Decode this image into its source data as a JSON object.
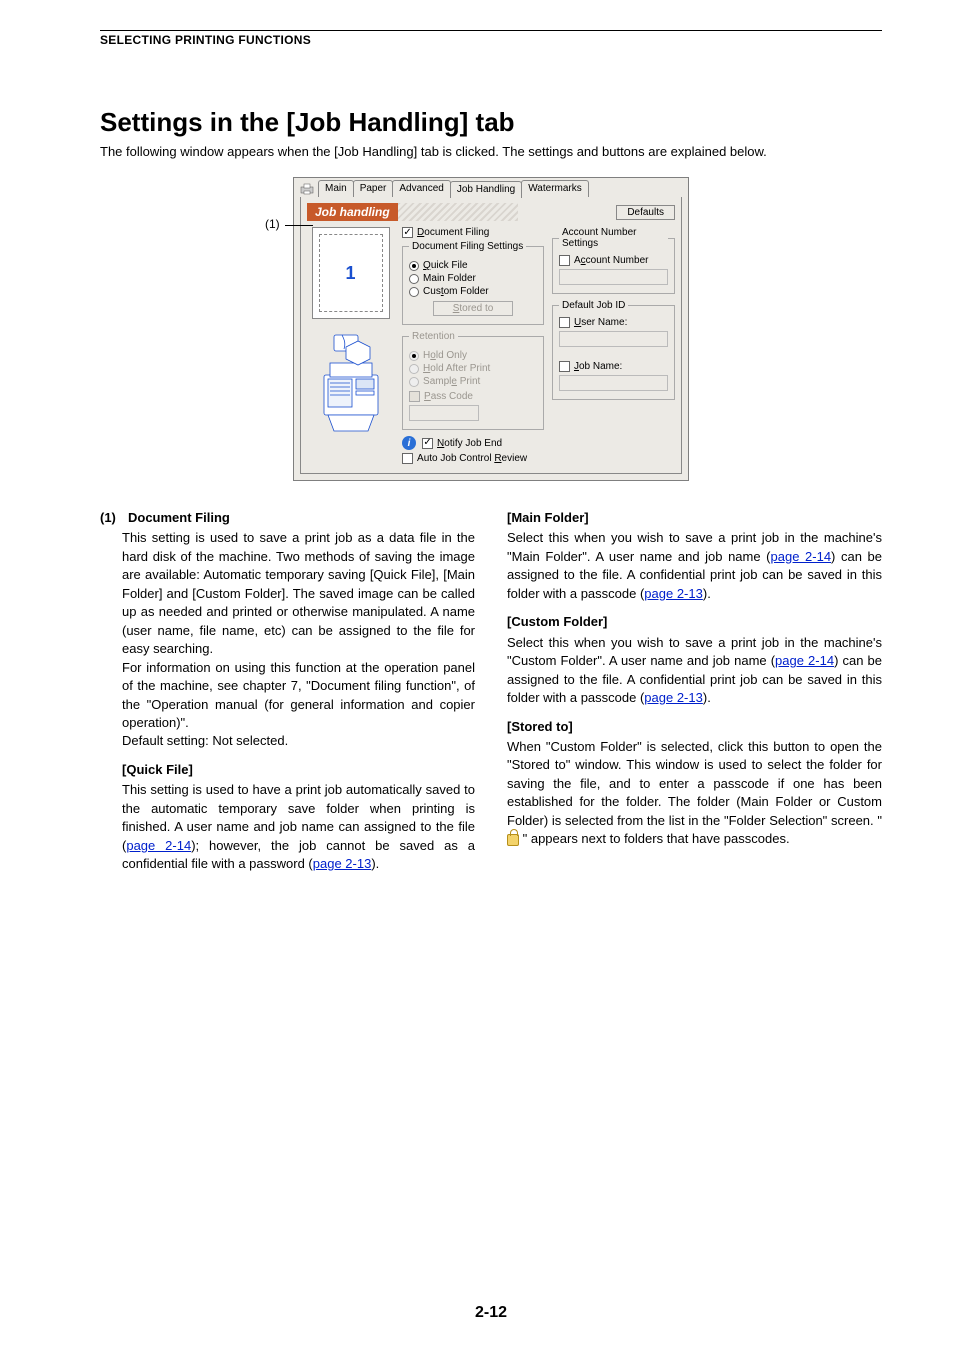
{
  "header": {
    "section": "SELECTING PRINTING FUNCTIONS"
  },
  "title": "Settings in the [Job Handling] tab",
  "intro": "The following window appears when the [Job Handling] tab is clicked. The settings and buttons are explained below.",
  "callout1": "(1)",
  "dialog": {
    "tabs": {
      "main": "Main",
      "paper": "Paper",
      "advanced": "Advanced",
      "job": "Job Handling",
      "water": "Watermarks"
    },
    "banner": "Job handling",
    "defaults": "Defaults",
    "preview_num": "1",
    "doc_filing": "Document Filing",
    "dfs_legend": "Document Filing Settings",
    "quick": "Quick File",
    "mainf": "Main Folder",
    "customf": "Custom Folder",
    "stored": "Stored to",
    "ret_legend": "Retention",
    "hold_only": "Hold Only",
    "hold_after": "Hold After Print",
    "sample": "Sample Print",
    "passcode": "Pass Code",
    "notify": "Notify Job End",
    "autoreview": "Auto Job Control Review",
    "acct_legend": "Account Number Settings",
    "acct_num": "Account Number",
    "def_legend": "Default Job ID",
    "user_name": "User Name:",
    "job_name": "Job Name:"
  },
  "left": {
    "hd1_num": "(1)",
    "hd1": "Document Filing",
    "p1": "This setting is used to save a print job as a data file in the hard disk of the machine. Two methods of saving the image are available: Automatic temporary saving [Quick File], [Main Folder] and [Custom Folder]. The saved image can be called up as needed and printed or otherwise manipulated. A name (user name, file name, etc) can be assigned to the file for easy searching.",
    "p2a": "For information on using this function at the operation panel of the machine, see chapter 7, \"Document filing function\", of the \"Operation manual (for general information and copier operation)\".",
    "p2b": "Default setting: Not selected.",
    "sub1": "[Quick File]",
    "p3a": "This setting is used to have a print job automatically saved to the automatic temporary save folder when printing is finished. A user name and job name can assigned to the file (",
    "p3link": "page 2-14",
    "p3b": "); however, the job cannot be saved as a confidential file with a password (",
    "p3link2": "page 2-13",
    "p3c": ")."
  },
  "right": {
    "sub1": "[Main Folder]",
    "r1a": "Select this when you wish to save a print job in the machine's \"Main Folder\". A user name and job name (",
    "r1link": "page 2-14",
    "r1b": ") can be assigned to the file. A confidential print job can be saved in this folder with a passcode (",
    "r1link2": "page 2-13",
    "r1c": ").",
    "sub2": "[Custom Folder]",
    "r2a": "Select this when you wish to save a print job in the machine's \"Custom Folder\". A user name and job name (",
    "r2link": "page 2-14",
    "r2b": ") can be assigned to the file. A confidential print job can be saved in this folder with a passcode (",
    "r2link2": "page 2-13",
    "r2c": ").",
    "sub3": "[Stored to]",
    "r3a": "When \"Custom Folder\" is selected, click this button to open the \"Stored to\" window. This window is used to select the folder for saving the file, and to enter a passcode if one has been established for the folder. The folder (Main Folder or Custom Folder) is selected from the list in the \"Folder Selection\" screen. \" ",
    "r3b": " \" appears next to folders that have passcodes."
  },
  "pagenum": "2-12"
}
